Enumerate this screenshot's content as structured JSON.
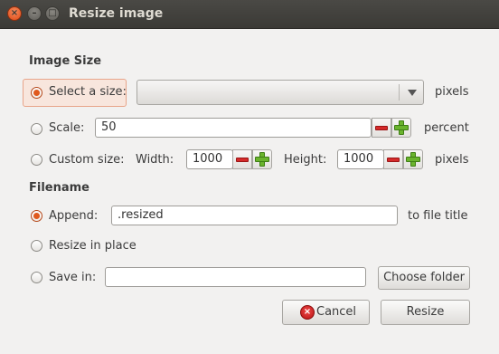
{
  "window": {
    "title": "Resize image",
    "close_glyph": "×",
    "min_glyph": "–",
    "max_glyph": "□"
  },
  "image_size": {
    "heading": "Image Size",
    "select_size": {
      "label": "Select a size:",
      "value": "",
      "unit": "pixels",
      "selected": true
    },
    "scale": {
      "label": "Scale:",
      "value": "50",
      "unit": "percent",
      "selected": false
    },
    "custom_size": {
      "label": "Custom size:",
      "width_label": "Width:",
      "width_value": "1000",
      "height_label": "Height:",
      "height_value": "1000",
      "unit": "pixels",
      "selected": false
    }
  },
  "filename": {
    "heading": "Filename",
    "append": {
      "label": "Append:",
      "value": ".resized",
      "suffix": "to file title",
      "selected": true
    },
    "resize_in_place": {
      "label": "Resize in place",
      "selected": false
    },
    "save_in": {
      "label": "Save in:",
      "value": "",
      "button": "Choose folder",
      "selected": false
    }
  },
  "buttons": {
    "cancel": "Cancel",
    "cancel_glyph": "×",
    "resize": "Resize"
  },
  "icons": {
    "decrease": "minus-icon",
    "increase": "plus-icon",
    "cancel": "cancel-icon"
  },
  "colors": {
    "accent": "#e05a1e",
    "minus": "#d52a2a",
    "plus": "#6ab42d",
    "titlebar": "#3c3b37"
  }
}
